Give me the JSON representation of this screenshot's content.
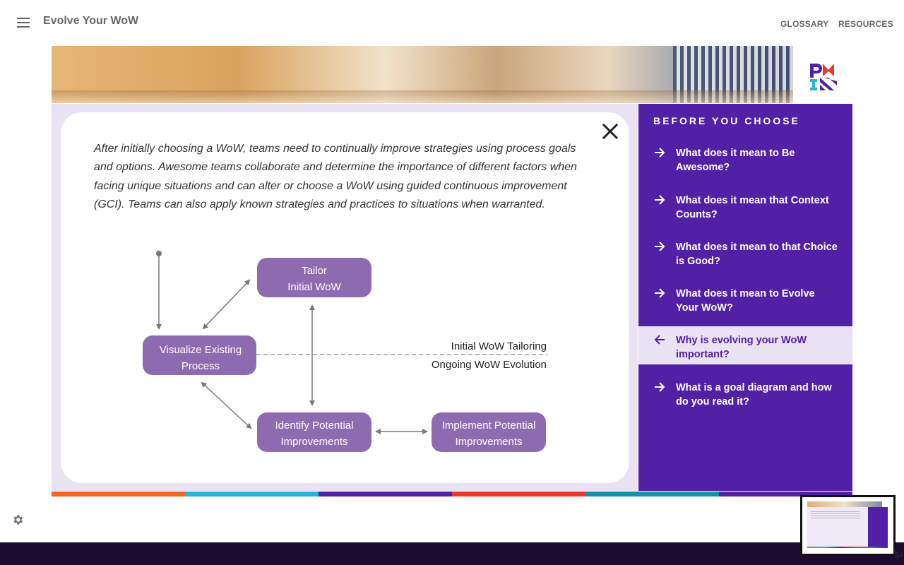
{
  "header": {
    "title": "Evolve Your WoW",
    "nav": [
      "GLOSSARY",
      "RESOURCES"
    ]
  },
  "main": {
    "intro": "After initially choosing a WoW, teams need to continually improve strategies using process goals and options. Awesome teams collaborate and determine the importance of different factors when facing unique situations and can alter or choose a WoW using guided continuous improvement (GCI). Teams can also apply known strategies and practices to situations when warranted.",
    "diagram": {
      "nodes": {
        "tailor": [
          "Tailor",
          "Initial WoW"
        ],
        "visualize": [
          "Visualize Existing",
          "Process"
        ],
        "identify": [
          "Identify Potential",
          "Improvements"
        ],
        "implement": [
          "Implement Potential",
          "Improvements"
        ]
      },
      "divider_above": "Initial WoW Tailoring",
      "divider_below": "Ongoing WoW Evolution"
    }
  },
  "sidebar": {
    "title": "BEFORE YOU CHOOSE",
    "items": [
      {
        "label": "What does it mean to Be Awesome?",
        "active": false
      },
      {
        "label": "What does it mean that Context Counts?",
        "active": false
      },
      {
        "label": "What does it mean to that Choice is Good?",
        "active": false
      },
      {
        "label": "What does it mean to Evolve Your WoW?",
        "active": false
      },
      {
        "label": "Why is evolving your WoW important?",
        "active": true
      },
      {
        "label": "What is a goal diagram and how do you read it?",
        "active": false
      }
    ]
  },
  "colors": {
    "accent": "#5220a5",
    "node_fill": "#8e6bb0",
    "content_bg": "#e9e2f3",
    "footer": "#1c0b2e",
    "color_bar": [
      "#f26522",
      "#2ab4d4",
      "#5220a5",
      "#e8392a",
      "#1590a6",
      "#5220a5"
    ]
  },
  "icons": {
    "menu": "hamburger-icon",
    "close": "close-icon",
    "forward": "arrow-right-icon",
    "back": "arrow-left-icon",
    "settings": "gear-icon",
    "logo": "pmi-logo"
  }
}
